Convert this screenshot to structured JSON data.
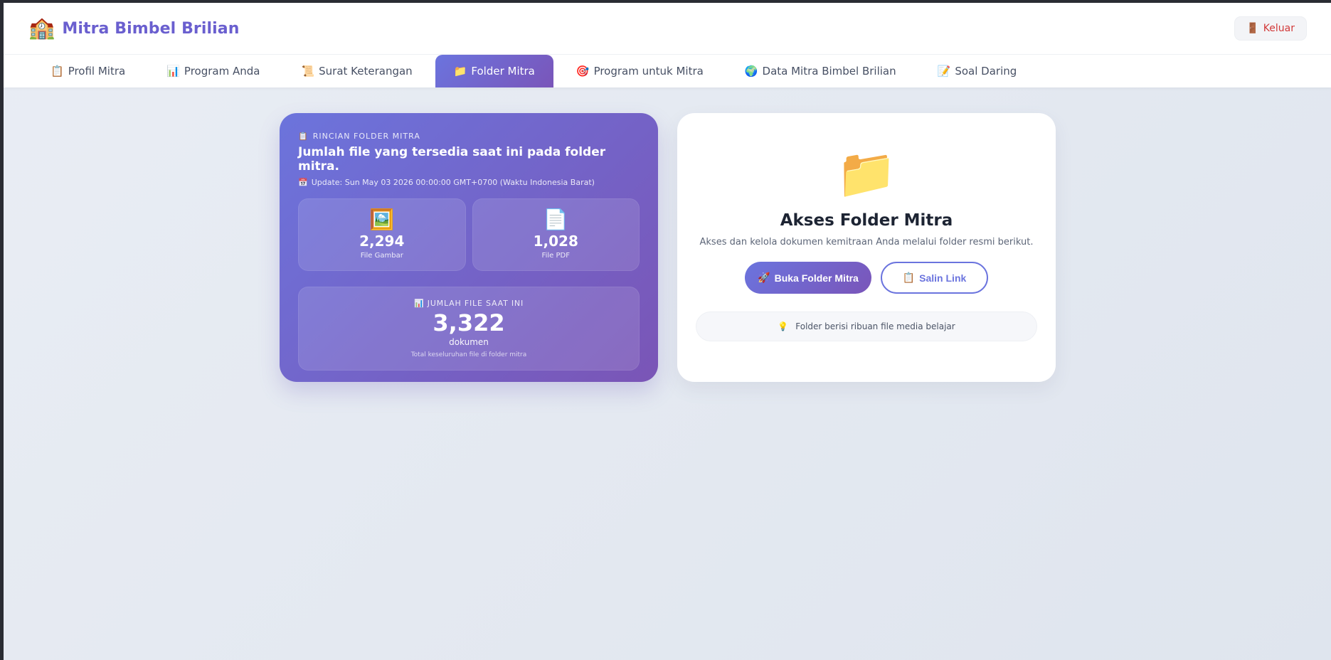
{
  "header": {
    "brand_icon": "🏫",
    "brand_name": "Mitra Bimbel Brilian",
    "logout_icon": "🚪",
    "logout_label": "Keluar"
  },
  "nav": {
    "tabs": [
      {
        "icon": "📋",
        "label": "Profil Mitra",
        "active": false
      },
      {
        "icon": "📊",
        "label": "Program Anda",
        "active": false
      },
      {
        "icon": "📜",
        "label": "Surat Keterangan",
        "active": false
      },
      {
        "icon": "📁",
        "label": "Folder Mitra",
        "active": true
      },
      {
        "icon": "🎯",
        "label": "Program untuk Mitra",
        "active": false
      },
      {
        "icon": "🌍",
        "label": "Data Mitra Bimbel Brilian",
        "active": false
      },
      {
        "icon": "📝",
        "label": "Soal Daring",
        "active": false
      }
    ]
  },
  "stats": {
    "eyebrow_icon": "📋",
    "eyebrow": "RINCIAN FOLDER MITRA",
    "title": "Jumlah file yang tersedia saat ini pada folder mitra.",
    "update_icon": "📅",
    "update": "Update: Sun May 03 2026 00:00:00 GMT+0700 (Waktu Indonesia Barat)",
    "images": {
      "icon": "🖼️",
      "value": "2,294",
      "label": "File Gambar"
    },
    "pdfs": {
      "icon": "📄",
      "value": "1,028",
      "label": "File PDF"
    },
    "total": {
      "eyebrow_icon": "📊",
      "eyebrow": "JUMLAH FILE SAAT INI",
      "value": "3,322",
      "unit": "dokumen",
      "note": "Total keseluruhan file di folder mitra"
    }
  },
  "access": {
    "folder_icon": "📁",
    "title": "Akses Folder Mitra",
    "description": "Akses dan kelola dokumen kemitraan Anda melalui folder resmi berikut.",
    "open_icon": "🚀",
    "open_label": "Buka Folder Mitra",
    "copy_icon": "📋",
    "copy_label": "Salin Link",
    "tip_icon": "💡",
    "tip": "Folder berisi ribuan file media belajar"
  },
  "colors": {
    "brand": "#6a5fcf",
    "gradient_start": "#6b74de",
    "gradient_end": "#7a55b9",
    "logout": "#d23a3a"
  }
}
